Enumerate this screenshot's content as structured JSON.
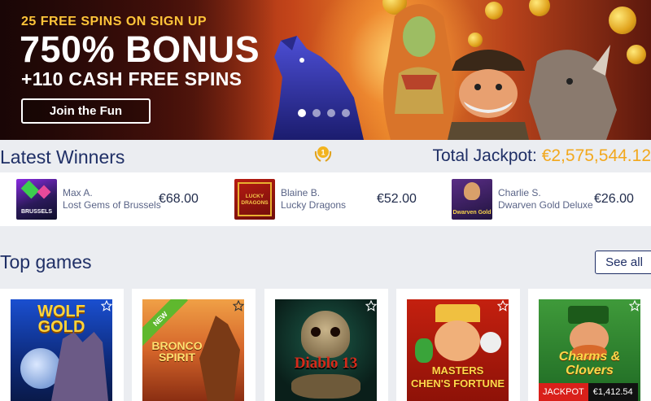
{
  "hero": {
    "tagline": "25 FREE SPINS ON SIGN UP",
    "headline": "750% BONUS",
    "subline": "+110 CASH FREE SPINS",
    "cta_label": "Join the Fun",
    "slides": 4,
    "active_slide": 1
  },
  "winners": {
    "title": "Latest Winners",
    "medal_number": "1",
    "jackpot_label": "Total Jackpot:",
    "jackpot_amount": "€2,575,544.12",
    "items": [
      {
        "name": "Max A.",
        "game": "Lost Gems of Brussels",
        "amount": "€68.00",
        "thumb_text": "BRUSSELS"
      },
      {
        "name": "Blaine B.",
        "game": "Lucky Dragons",
        "amount": "€52.00",
        "thumb_text": "LUCKY DRAGONS"
      },
      {
        "name": "Charlie S.",
        "game": "Dwarven Gold Deluxe",
        "amount": "€26.00",
        "thumb_text": "Dwarven Gold"
      }
    ]
  },
  "top_games": {
    "title": "Top games",
    "see_all_label": "See all",
    "games": [
      {
        "title_line1": "WOLF",
        "title_line2": "GOLD",
        "badge": ""
      },
      {
        "title_line1": "BRONCO",
        "title_line2": "SPIRIT",
        "badge": "NEW"
      },
      {
        "title_line1": "Diablo 13",
        "title_line2": "",
        "badge": ""
      },
      {
        "title_line1": "MASTERS",
        "title_line2": "CHEN'S FORTUNE",
        "badge": ""
      },
      {
        "title_line1": "Charms &",
        "title_line2": "Clovers",
        "badge": "",
        "jackpot_label": "JACKPOT",
        "jackpot_value": "€1,412.54"
      }
    ]
  },
  "colors": {
    "navy": "#1f2f66",
    "gold": "#f2a81d",
    "page_bg": "#ebedf1",
    "new_green": "#5fb82e",
    "jackpot_red": "#d9201a"
  }
}
